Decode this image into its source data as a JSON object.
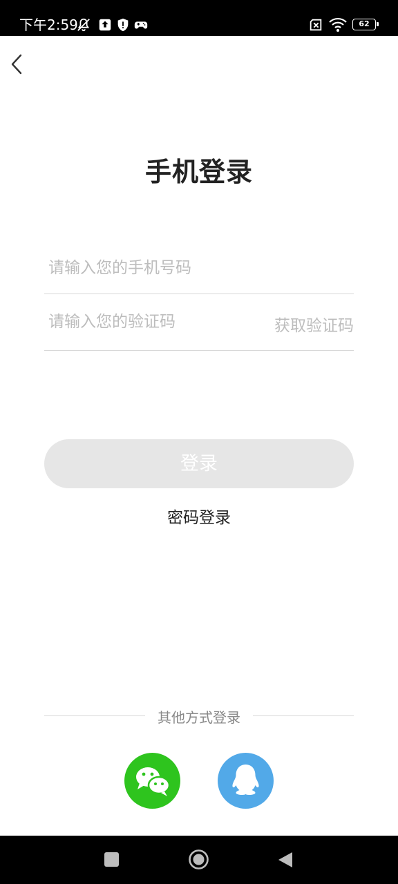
{
  "status_bar": {
    "time": "下午2:59",
    "battery": "62",
    "icons": [
      "notifications-off-icon",
      "upload-icon",
      "shield-alert-icon",
      "gamepad-icon",
      "sim-off-icon",
      "wifi-icon",
      "battery-icon"
    ]
  },
  "header": {
    "back_icon": "chevron-left-icon",
    "title": "手机登录"
  },
  "form": {
    "phone_placeholder": "请输入您的手机号码",
    "phone_value": "",
    "code_placeholder": "请输入您的验证码",
    "code_value": "",
    "get_code_label": "获取验证码"
  },
  "actions": {
    "login_label": "登录",
    "password_login_label": "密码登录"
  },
  "other_login": {
    "label": "其他方式登录",
    "providers": [
      {
        "name": "wechat-icon",
        "color": "#2ec41e"
      },
      {
        "name": "qq-icon",
        "color": "#52a9e8"
      }
    ]
  },
  "colors": {
    "login_button_disabled": "#e6e6e6",
    "placeholder": "#bdbdbd"
  }
}
